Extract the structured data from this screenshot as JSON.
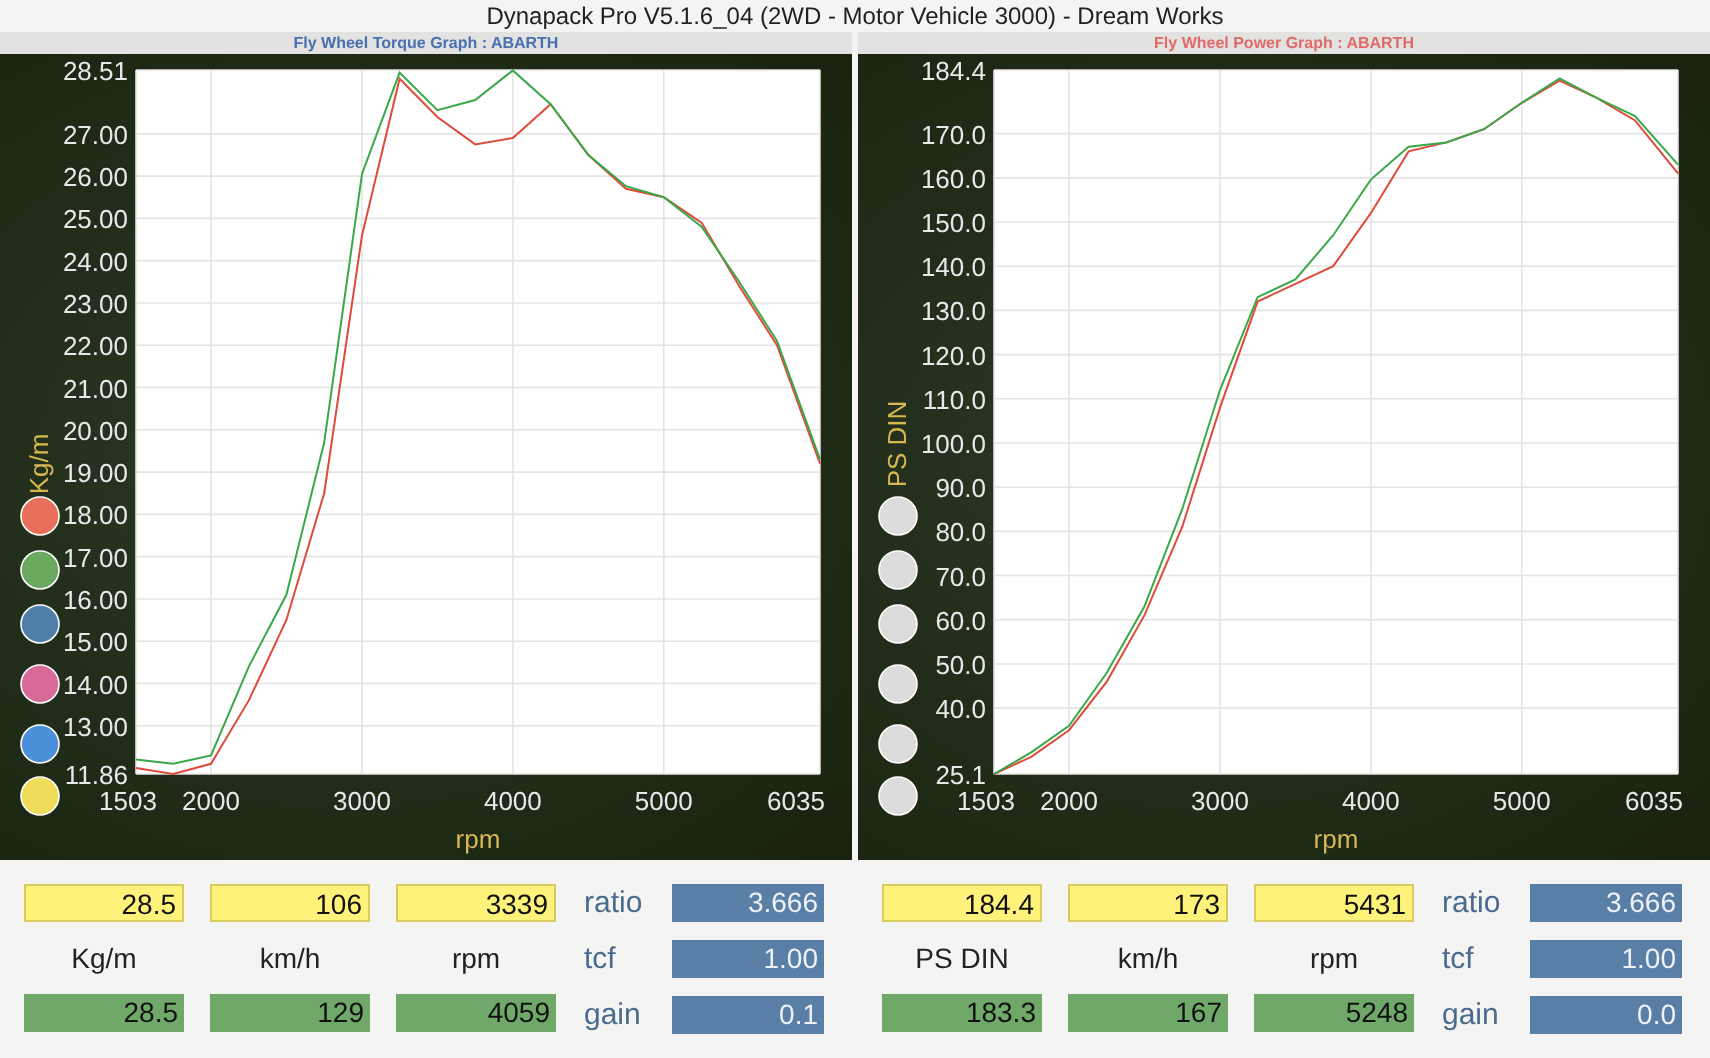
{
  "window": {
    "title": "Dynapack Pro V5.1.6_04 (2WD - Motor Vehicle 3000) - Dream Works"
  },
  "panels": [
    {
      "title": "Fly Wheel Torque Graph : ABARTH",
      "color": "#4a6fb0",
      "legend": [
        {
          "color": "#e8705a"
        },
        {
          "color": "#6aa860"
        },
        {
          "color": "#4f7fa8"
        },
        {
          "color": "#d86a9a"
        },
        {
          "color": "#4a90d8"
        },
        {
          "color": "#f0dc5a"
        }
      ],
      "chart_data": {
        "type": "line",
        "xlabel": "rpm",
        "ylabel": "Kg/m",
        "x": [
          1503,
          1750,
          2000,
          2250,
          2500,
          2750,
          3000,
          3250,
          3500,
          3750,
          4000,
          4250,
          4500,
          4750,
          5000,
          5250,
          5500,
          5750,
          6035
        ],
        "series": [
          {
            "color": "#e04a3a",
            "values": [
              12.0,
              11.86,
              12.1,
              13.6,
              15.5,
              18.5,
              24.6,
              28.3,
              27.4,
              26.75,
              26.9,
              27.7,
              26.5,
              25.7,
              25.5,
              24.9,
              23.4,
              22.0,
              19.2
            ]
          },
          {
            "color": "#3aa84a",
            "values": [
              12.2,
              12.1,
              12.3,
              14.4,
              16.1,
              19.7,
              26.05,
              28.45,
              27.56,
              27.8,
              28.5,
              27.7,
              26.5,
              25.76,
              25.5,
              24.8,
              23.5,
              22.1,
              19.3
            ]
          }
        ],
        "xlim": [
          1503,
          6035
        ],
        "ylim": [
          11.86,
          28.51
        ],
        "grid": true,
        "xticks": [
          1503,
          2000,
          3000,
          4000,
          5000,
          6035
        ],
        "yticks": [
          {
            "value": 28.51,
            "label": "28.51"
          },
          {
            "value": 27,
            "label": "27.00"
          },
          {
            "value": 26,
            "label": "26.00"
          },
          {
            "value": 25,
            "label": "25.00"
          },
          {
            "value": 24,
            "label": "24.00"
          },
          {
            "value": 23,
            "label": "23.00"
          },
          {
            "value": 22,
            "label": "22.00"
          },
          {
            "value": 21,
            "label": "21.00"
          },
          {
            "value": 20,
            "label": "20.00"
          },
          {
            "value": 19,
            "label": "19.00"
          },
          {
            "value": 18,
            "label": "18.00"
          },
          {
            "value": 17,
            "label": "17.00"
          },
          {
            "value": 16,
            "label": "16.00"
          },
          {
            "value": 15,
            "label": "15.00"
          },
          {
            "value": 14,
            "label": "14.00"
          },
          {
            "value": 13,
            "label": "13.00"
          },
          {
            "value": 11.86,
            "label": "11.86"
          }
        ]
      },
      "readouts": {
        "current": [
          "28.5",
          "106",
          "3339"
        ],
        "units": [
          "Kg/m",
          "km/h",
          "rpm"
        ],
        "peak": [
          "28.5",
          "129",
          "4059"
        ]
      },
      "factors": [
        {
          "label": "ratio",
          "value": "3.666"
        },
        {
          "label": "tcf",
          "value": "1.00"
        },
        {
          "label": "gain",
          "value": "0.1"
        }
      ]
    },
    {
      "title": "Fly Wheel Power Graph : ABARTH",
      "color": "#e06a6a",
      "legend": [
        {
          "color": "#dcdcdc"
        },
        {
          "color": "#dcdcdc"
        },
        {
          "color": "#dcdcdc"
        },
        {
          "color": "#dcdcdc"
        },
        {
          "color": "#dcdcdc"
        },
        {
          "color": "#dcdcdc"
        }
      ],
      "chart_data": {
        "type": "line",
        "xlabel": "rpm",
        "ylabel": "PS DIN",
        "x": [
          1503,
          1750,
          2000,
          2250,
          2500,
          2750,
          3000,
          3250,
          3500,
          3750,
          4000,
          4250,
          4500,
          4750,
          5000,
          5250,
          5500,
          5750,
          6035
        ],
        "series": [
          {
            "color": "#e04a3a",
            "values": [
              25.1,
              29,
              35,
              46,
              61,
              81,
              108,
              132,
              136,
              140,
              152,
              166,
              168,
              171,
              177,
              182,
              178,
              173,
              161
            ]
          },
          {
            "color": "#3aa84a",
            "values": [
              25.1,
              30,
              36,
              48,
              63,
              85,
              112,
              133,
              137,
              147,
              159.6,
              167,
              168,
              171,
              177,
              182.5,
              178,
              174,
              163
            ]
          }
        ],
        "xlim": [
          1503,
          6035
        ],
        "ylim": [
          25.1,
          184.4
        ],
        "grid": true,
        "xticks": [
          1503,
          2000,
          3000,
          4000,
          5000,
          6035
        ],
        "yticks": [
          {
            "value": 184.4,
            "label": "184.4"
          },
          {
            "value": 170,
            "label": "170.0"
          },
          {
            "value": 160,
            "label": "160.0"
          },
          {
            "value": 150,
            "label": "150.0"
          },
          {
            "value": 140,
            "label": "140.0"
          },
          {
            "value": 130,
            "label": "130.0"
          },
          {
            "value": 120,
            "label": "120.0"
          },
          {
            "value": 110,
            "label": "110.0"
          },
          {
            "value": 100,
            "label": "100.0"
          },
          {
            "value": 90,
            "label": "90.0"
          },
          {
            "value": 80,
            "label": "80.0"
          },
          {
            "value": 70,
            "label": "70.0"
          },
          {
            "value": 60,
            "label": "60.0"
          },
          {
            "value": 50,
            "label": "50.0"
          },
          {
            "value": 40,
            "label": "40.0"
          },
          {
            "value": 25.1,
            "label": "25.1"
          }
        ]
      },
      "readouts": {
        "current": [
          "184.4",
          "173",
          "5431"
        ],
        "units": [
          "PS DIN",
          "km/h",
          "rpm"
        ],
        "peak": [
          "183.3",
          "167",
          "5248"
        ]
      },
      "factors": [
        {
          "label": "ratio",
          "value": "3.666"
        },
        {
          "label": "tcf",
          "value": "1.00"
        },
        {
          "label": "gain",
          "value": "0.0"
        }
      ]
    }
  ]
}
